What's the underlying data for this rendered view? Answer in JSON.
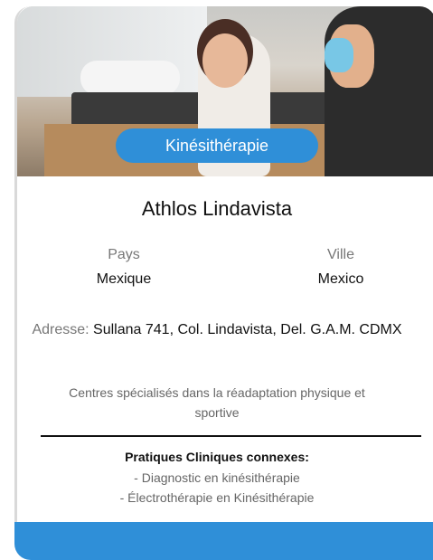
{
  "card": {
    "category_badge": "Kinésithérapie",
    "title": "Athlos Lindavista",
    "country": {
      "label": "Pays",
      "value": "Mexique"
    },
    "city": {
      "label": "Ville",
      "value": "Mexico"
    },
    "address": {
      "label": "Adresse:",
      "value": "Sullana 741, Col. Lindavista, Del. G.A.M. CDMX"
    },
    "description": "Centres spécialisés dans la réadaptation physique et sportive",
    "practices": {
      "heading": "Pratiques Cliniques connexes:",
      "items": [
        "- Diagnostic en kinésithérapie",
        "- Électrothérapie en Kinésithérapie"
      ]
    }
  },
  "colors": {
    "accent": "#2f8fd8",
    "text": "#111111",
    "muted": "#777777"
  },
  "hero_image": {
    "semantic": "child-physiotherapy-photo"
  }
}
